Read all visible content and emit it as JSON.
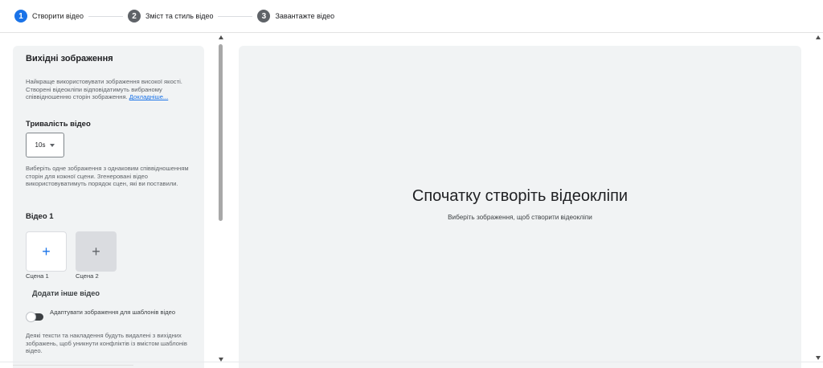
{
  "stepper": {
    "steps": [
      {
        "number": "1",
        "label": "Створити відео",
        "state": "active"
      },
      {
        "number": "2",
        "label": "Зміст та стиль відео",
        "state": "inactive"
      },
      {
        "number": "3",
        "label": "Завантажте відео",
        "state": "inactive"
      }
    ]
  },
  "left_panel": {
    "title": "Вихідні зображення",
    "description": "Найкраще використовувати зображення високої якості. Створені відеокліпи відповідатимуть вибраному співвідношенню сторін зображення.",
    "learn_more": "Докладніше...",
    "duration_title": "Тривалість відео",
    "duration_value": "10s",
    "scene_hint": "Виберіть одне зображення з однаковим співвідношенням сторін для кожної сцени. Згенеровані відео використовуватимуть порядок сцен, які ви поставили.",
    "video_title": "Відео 1",
    "scenes": [
      {
        "label": "Сцена 1",
        "icon": "plus-icon"
      },
      {
        "label": "Сцена 2",
        "icon": "plus-icon"
      }
    ],
    "add_video": "Додати інше відео",
    "toggle_label": "Адаптувати зображення для шаблонів відео",
    "toggle_state": "off",
    "note": "Деякі тексти та накладення будуть видалені з вихідних зображень, щоб уникнути конфліктів із вмістом шаблонів відео."
  },
  "preview": {
    "title": "Спочатку створіть відеокліпи",
    "subtitle": "Виберіть зображення, щоб створити відеокліпи"
  },
  "colors": {
    "accent": "#1a73e8",
    "panel_bg": "#f1f3f4",
    "inactive_step": "#5f6368"
  }
}
